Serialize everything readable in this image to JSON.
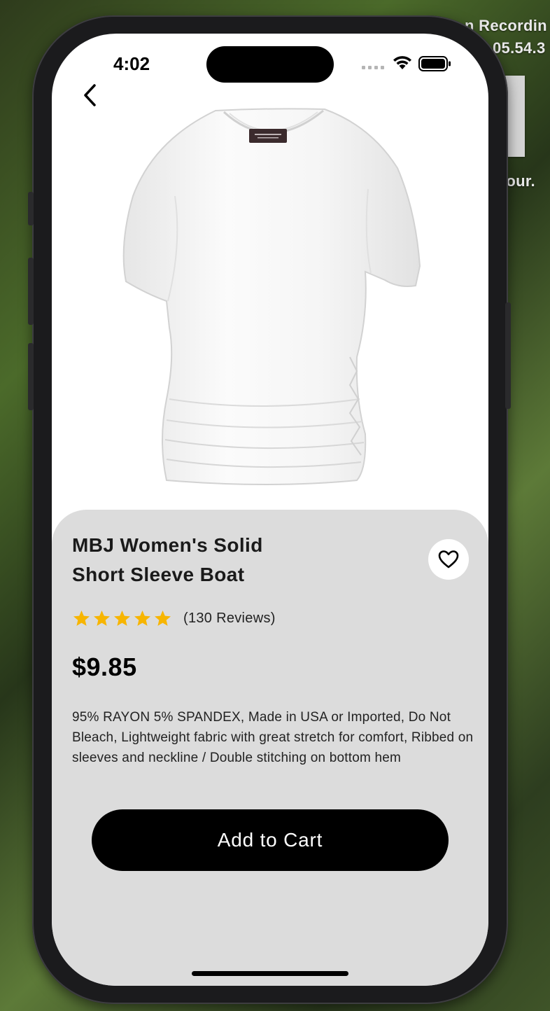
{
  "desktop": {
    "labels": [
      "n Recordin",
      "05.54.3",
      "ntour."
    ]
  },
  "status_bar": {
    "time": "4:02"
  },
  "nav": {
    "back_icon": "chevron-left-icon"
  },
  "product": {
    "image_alt": "white-short-sleeve-boat-neck-top",
    "title_line1": "MBJ Women's Solid",
    "title_line2": "Short Sleeve Boat",
    "favorite_icon": "heart-icon",
    "rating": {
      "stars": 5,
      "max": 5,
      "reviews_label": "(130 Reviews)",
      "star_color": "#f7b500"
    },
    "price": "$9.85",
    "description": "95% RAYON 5% SPANDEX, Made in USA or Imported, Do Not Bleach, Lightweight fabric with great stretch for comfort, Ribbed on sleeves and neckline / Double stitching on bottom hem"
  },
  "actions": {
    "add_to_cart": "Add to Cart"
  },
  "colors": {
    "panel": "#dcdcdc",
    "button": "#000000",
    "button_text": "#ffffff"
  }
}
